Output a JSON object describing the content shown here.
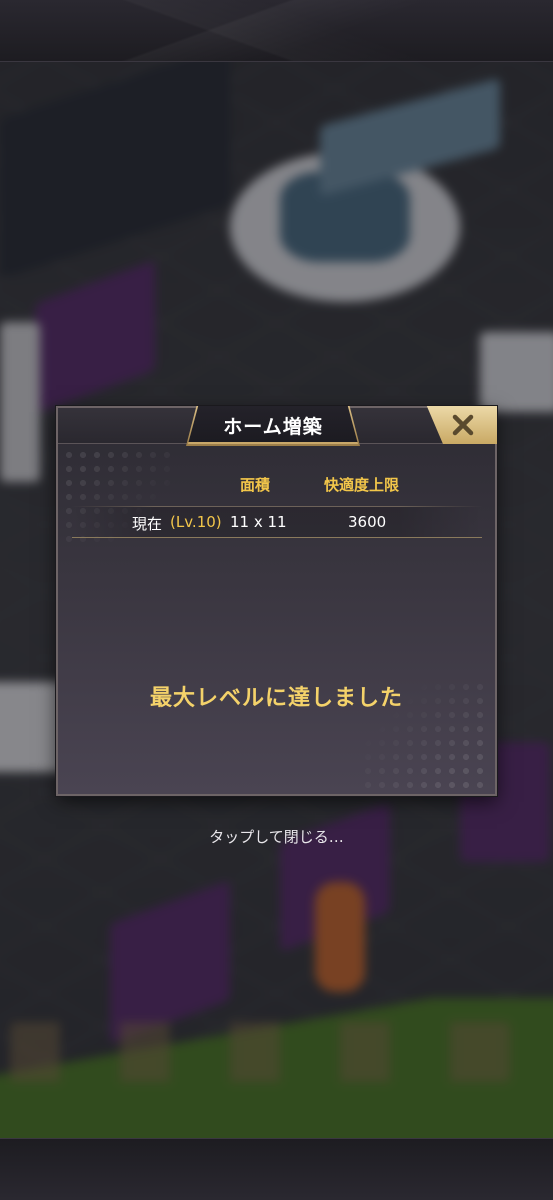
{
  "dialog": {
    "title": "ホーム増築",
    "columns": {
      "area": "面積",
      "comfort_cap": "快適度上限"
    },
    "current": {
      "label": "現在",
      "level": "(Lv.10)",
      "area": "11 x 11",
      "comfort_cap": "3600"
    },
    "message": "最大レベルに達しました",
    "close_icon": "close-icon"
  },
  "hint": "タップして閉じる…",
  "colors": {
    "accent_gold": "#f2c64a",
    "frame_gold": "#c9a964",
    "panel": "#3a3640"
  }
}
